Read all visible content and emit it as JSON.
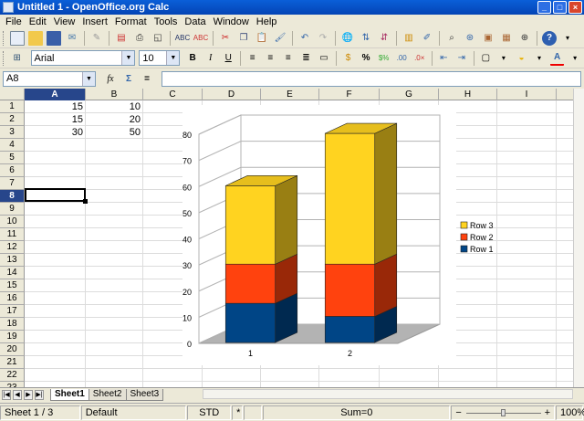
{
  "window": {
    "title": "Untitled 1 - OpenOffice.org Calc"
  },
  "menu": [
    "File",
    "Edit",
    "View",
    "Insert",
    "Format",
    "Tools",
    "Data",
    "Window",
    "Help"
  ],
  "format_bar": {
    "font_name": "Arial",
    "font_size": "10",
    "bold": "B",
    "italic": "I",
    "underline": "U"
  },
  "formula_bar": {
    "name_box": "A8",
    "formula": ""
  },
  "columns": [
    "A",
    "B",
    "C",
    "D",
    "E",
    "F",
    "G",
    "H",
    "I"
  ],
  "rows": [
    "1",
    "2",
    "3",
    "4",
    "5",
    "6",
    "7",
    "8",
    "9",
    "10",
    "11",
    "12",
    "13",
    "14",
    "15",
    "16",
    "17",
    "18",
    "19",
    "20",
    "21",
    "22",
    "23"
  ],
  "selected": {
    "column": "A",
    "row": "8"
  },
  "cells": [
    {
      "ref": "A1",
      "value": "15"
    },
    {
      "ref": "B1",
      "value": "10"
    },
    {
      "ref": "A2",
      "value": "15"
    },
    {
      "ref": "B2",
      "value": "20"
    },
    {
      "ref": "A3",
      "value": "30"
    },
    {
      "ref": "B3",
      "value": "50"
    }
  ],
  "chart_data": {
    "type": "bar",
    "stacked": true,
    "three_d": true,
    "categories": [
      "1",
      "2"
    ],
    "series": [
      {
        "name": "Row 1",
        "values": [
          15,
          10
        ],
        "color": "#004586"
      },
      {
        "name": "Row 2",
        "values": [
          15,
          20
        ],
        "color": "#ff420e"
      },
      {
        "name": "Row 3",
        "values": [
          30,
          50
        ],
        "color": "#ffd320"
      }
    ],
    "ylim": [
      0,
      80
    ],
    "yticks": [
      "0",
      "10",
      "20",
      "30",
      "40",
      "50",
      "60",
      "70",
      "80"
    ],
    "grid": true,
    "legend": "right"
  },
  "sheets": {
    "tabs": [
      "Sheet1",
      "Sheet2",
      "Sheet3"
    ],
    "active": "Sheet1"
  },
  "status": {
    "sheet": "Sheet 1 / 3",
    "style": "Default",
    "mode": "STD",
    "modified": "*",
    "sum": "Sum=0",
    "zoom": "100%"
  }
}
